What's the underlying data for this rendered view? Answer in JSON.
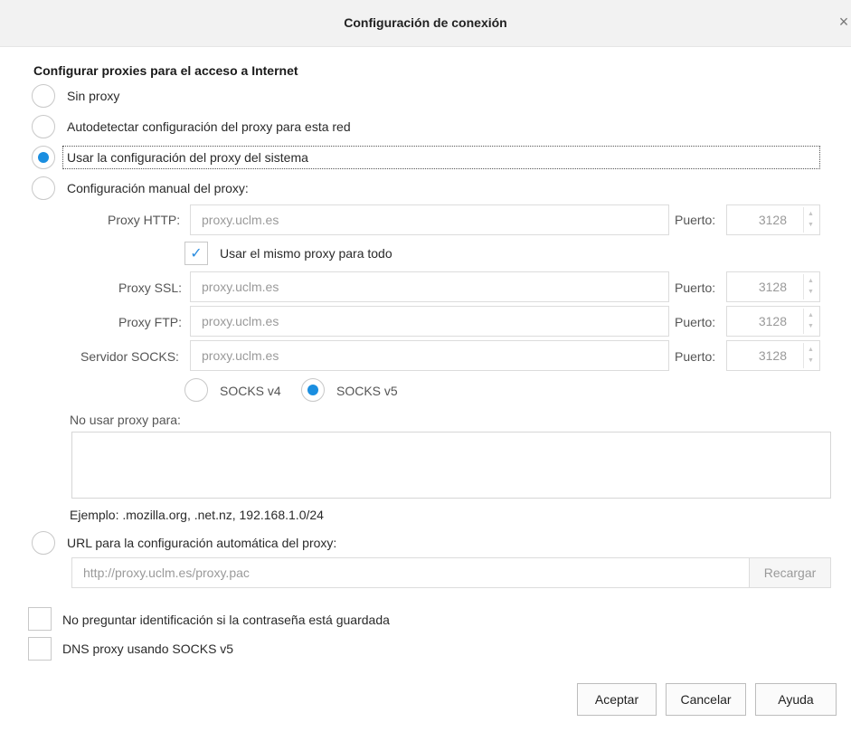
{
  "dialog": {
    "title": "Configuración de conexión",
    "close_glyph": "×"
  },
  "section": {
    "heading": "Configurar proxies para el acceso a Internet"
  },
  "proxy_options": [
    {
      "label": "Sin proxy",
      "selected": false
    },
    {
      "label": "Autodetectar configuración del proxy para esta red",
      "selected": false
    },
    {
      "label": "Usar la configuración del proxy del sistema",
      "selected": true
    },
    {
      "label": "Configuración manual del proxy:",
      "selected": false
    }
  ],
  "manual": {
    "http": {
      "label": "Proxy HTTP:",
      "value": "proxy.uclm.es",
      "port_label": "Puerto:",
      "port": "3128"
    },
    "same_proxy": {
      "label": "Usar el mismo proxy para todo",
      "checked": true
    },
    "ssl": {
      "label": "Proxy SSL:",
      "value": "proxy.uclm.es",
      "port_label": "Puerto:",
      "port": "3128"
    },
    "ftp": {
      "label": "Proxy FTP:",
      "value": "proxy.uclm.es",
      "port_label": "Puerto:",
      "port": "3128"
    },
    "socks": {
      "label": "Servidor SOCKS:",
      "value": "proxy.uclm.es",
      "port_label": "Puerto:",
      "port": "3128"
    },
    "socks_v4": {
      "label": "SOCKS v4",
      "selected": false
    },
    "socks_v5": {
      "label": "SOCKS v5",
      "selected": true
    }
  },
  "no_proxy": {
    "label": "No usar proxy para:",
    "value": "",
    "example": "Ejemplo: .mozilla.org, .net.nz, 192.168.1.0/24"
  },
  "auto_url": {
    "label": "URL para la configuración automática del proxy:",
    "selected": false,
    "value": "http://proxy.uclm.es/proxy.pac",
    "reload_label": "Recargar"
  },
  "checkboxes": [
    {
      "label": "No preguntar identificación si la contraseña está guardada",
      "checked": false
    },
    {
      "label": "DNS proxy usando SOCKS v5",
      "checked": false
    }
  ],
  "buttons": {
    "accept": "Aceptar",
    "cancel": "Cancelar",
    "help": "Ayuda"
  },
  "colors": {
    "accent": "#1a8ee0",
    "titlebar": "#f2f2f2"
  },
  "icons": {
    "close": "close-icon",
    "check": "checkmark-icon",
    "spin_up": "spin-up-icon",
    "spin_down": "spin-down-icon"
  }
}
